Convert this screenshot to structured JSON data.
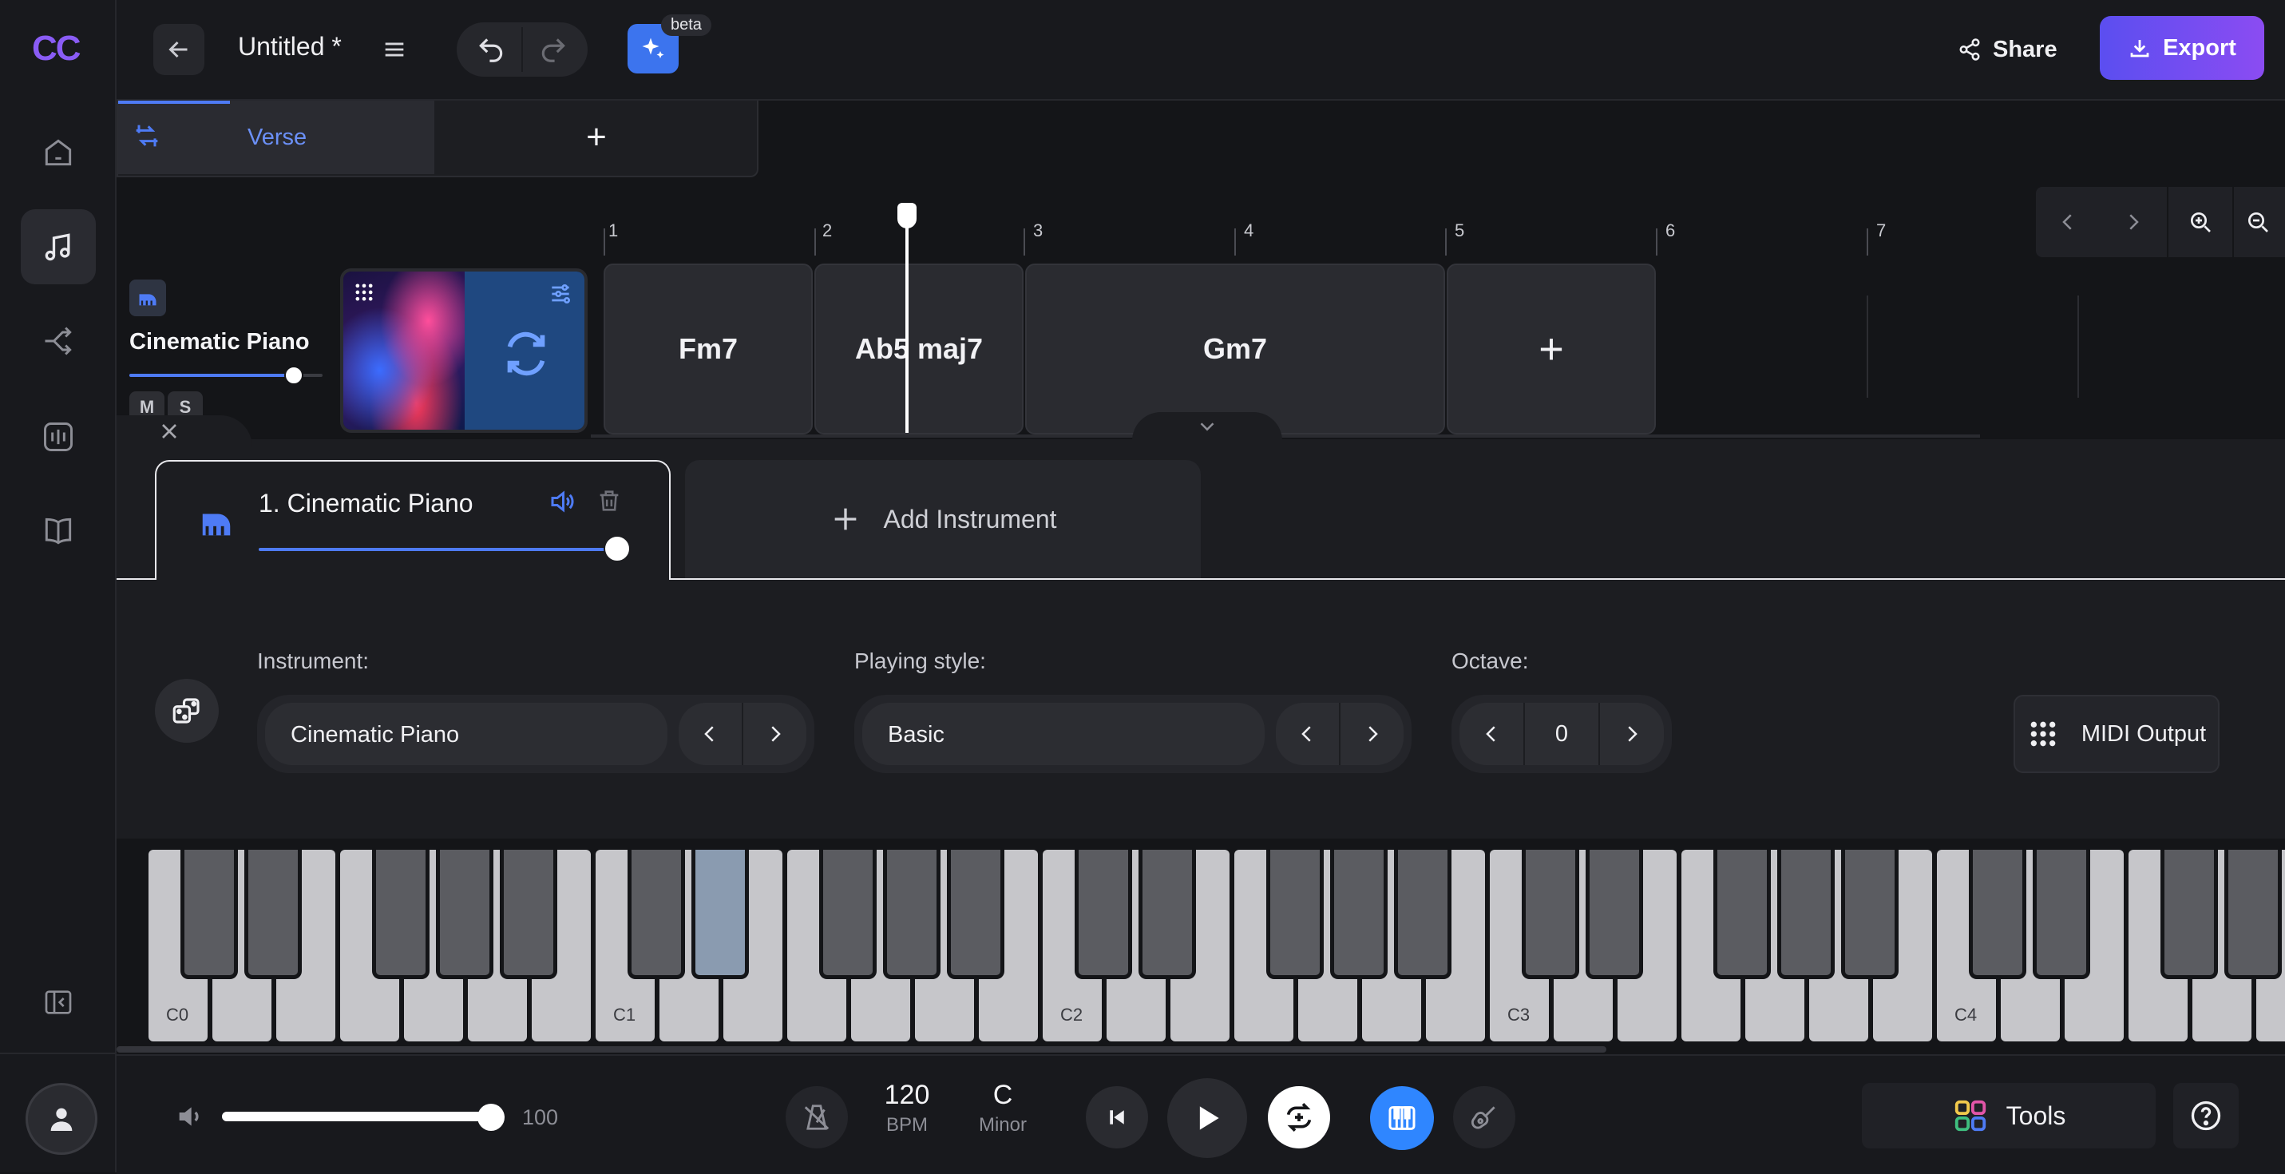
{
  "app": {
    "logo": "CC"
  },
  "header": {
    "title": "Untitled *",
    "beta_badge": "beta",
    "share_label": "Share",
    "export_label": "Export"
  },
  "sections": {
    "items": [
      {
        "label": "Verse"
      }
    ],
    "add_label": "+"
  },
  "ruler": {
    "bars": [
      "1",
      "2",
      "3",
      "4",
      "5",
      "6",
      "7"
    ]
  },
  "track": {
    "name": "Cinematic Piano",
    "mute": "M",
    "solo": "S"
  },
  "chords": [
    {
      "label": "Fm7"
    },
    {
      "label": "Ab5 maj7"
    },
    {
      "label": "Gm7"
    }
  ],
  "chord_add_label": "+",
  "instrument_tabs": {
    "tab1": "1. Cinematic Piano",
    "add": "Add Instrument"
  },
  "settings": {
    "instrument_label": "Instrument:",
    "instrument_value": "Cinematic Piano",
    "style_label": "Playing style:",
    "style_value": "Basic",
    "octave_label": "Octave:",
    "octave_value": "0",
    "midi_label": "MIDI Output"
  },
  "keyboard": {
    "octave_labels": [
      "C0",
      "C1",
      "C2",
      "C3",
      "C4"
    ]
  },
  "transport": {
    "volume": "100",
    "volume_fraction": 1.0,
    "track_volume_fraction": 0.85,
    "instrument_volume_fraction": 1.0,
    "bpm_value": "120",
    "bpm_label": "BPM",
    "key_value": "C",
    "key_mode": "Minor",
    "tools_label": "Tools"
  },
  "colors": {
    "accent": "#4e7bf5",
    "export_gradient_start": "#5b4ef0",
    "export_gradient_end": "#8b4cf2",
    "piano_button": "#2f86ff",
    "highlight_key": "#8a9bb0"
  },
  "icons": {
    "rail": [
      "home-icon",
      "music-note-icon",
      "branch-icon",
      "equalizer-icon",
      "book-icon",
      "collapse-icon",
      "user-icon"
    ]
  }
}
